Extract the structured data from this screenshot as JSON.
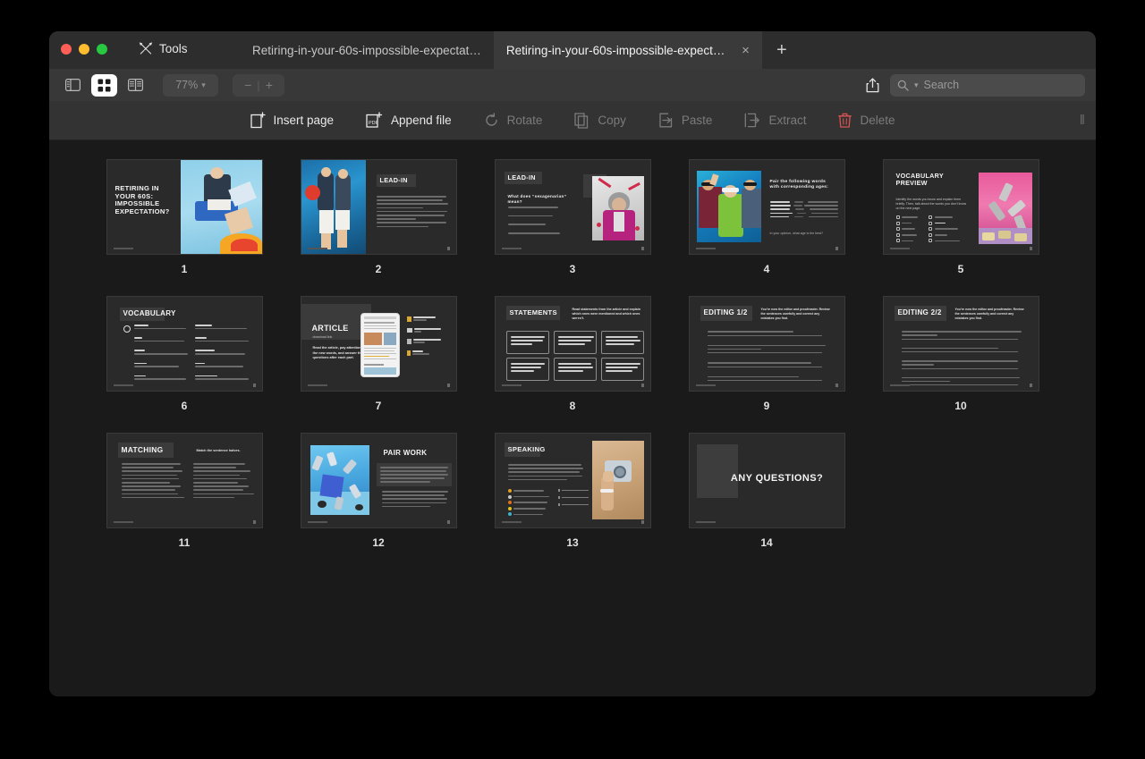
{
  "window": {
    "tools_label": "Tools",
    "traffic_lights": [
      "close",
      "minimize",
      "zoom"
    ]
  },
  "tabs": [
    {
      "label": "Retiring-in-your-60s-impossible-expectat…",
      "active": false
    },
    {
      "label": "Retiring-in-your-60s-impossible-expect…",
      "active": true
    }
  ],
  "new_tab_label": "+",
  "tab_close_label": "×",
  "toolbar": {
    "view_sidebar_icon": "sidebar-icon",
    "view_grid_icon": "grid-icon",
    "view_split_icon": "split-view-icon",
    "zoom_level": "77%",
    "zoom_chevron": "⌄",
    "zoom_out": "−",
    "zoom_sep": "|",
    "zoom_in": "+",
    "share_icon": "share-icon",
    "search_placeholder": "Search",
    "search_value": ""
  },
  "actions": [
    {
      "label": "Insert page",
      "icon": "insert-page-icon",
      "enabled": true
    },
    {
      "label": "Append file",
      "icon": "append-file-icon",
      "enabled": true
    },
    {
      "label": "Rotate",
      "icon": "rotate-icon",
      "enabled": false
    },
    {
      "label": "Copy",
      "icon": "copy-icon",
      "enabled": false
    },
    {
      "label": "Paste",
      "icon": "paste-icon",
      "enabled": false
    },
    {
      "label": "Extract",
      "icon": "extract-icon",
      "enabled": false
    },
    {
      "label": "Delete",
      "icon": "trash-icon",
      "enabled": false
    }
  ],
  "grip_label": "‖",
  "pages": [
    {
      "number": "1",
      "title": "RETIRING IN YOUR 60S: IMPOSSIBLE EXPECTATION?",
      "layout": "title-right-image",
      "selected": false
    },
    {
      "number": "2",
      "title": "LEAD-IN",
      "layout": "image-left-list-right",
      "selected": false
    },
    {
      "number": "3",
      "title": "LEAD-IN",
      "subtitle": "What does “sexagenarian” mean?",
      "layout": "list-left-image-right",
      "selected": false
    },
    {
      "number": "4",
      "title": "",
      "subtitle": "Pair the following words with corresponding ages:",
      "note": "In your opinion, what age is the best?",
      "layout": "image-left-pairs-right",
      "selected": false
    },
    {
      "number": "5",
      "title": "VOCABULARY PREVIEW",
      "subtitle": "Identify the words you know and explain them briefly. Then, talk about the words you don’t know on the next page.",
      "layout": "checklist-left-image-right",
      "selected": false
    },
    {
      "number": "6",
      "title": "VOCABULARY",
      "layout": "two-column-glossary",
      "selected": false
    },
    {
      "number": "7",
      "title": "ARTICLE",
      "subtitle": "download link",
      "body": "Read the article, pay attention to the new words, and answer the questions after each part.",
      "layout": "article-tablet",
      "selected": false
    },
    {
      "number": "8",
      "title": "STATEMENTS",
      "subtitle": "Read statements from the article and explain which ones were mentioned and which ones weren’t.",
      "layout": "statement-boxes",
      "selected": false
    },
    {
      "number": "9",
      "title": "EDITING 1/2",
      "subtitle": "You’re now the editor and proofreader. Review the sentences carefully and correct any mistakes you find.",
      "layout": "editing-lines",
      "selected": false
    },
    {
      "number": "10",
      "title": "EDITING 2/2",
      "subtitle": "You’re now the editor and proofreader. Review the sentences carefully and correct any mistakes you find.",
      "layout": "editing-lines",
      "selected": false
    },
    {
      "number": "11",
      "title": "MATCHING",
      "subtitle": "Match the sentence halves.",
      "layout": "matching-columns",
      "selected": false
    },
    {
      "number": "12",
      "title": "PAIR WORK",
      "layout": "image-left-quote-right",
      "selected": false
    },
    {
      "number": "13",
      "title": "SPEAKING",
      "layout": "speaking-image-right",
      "selected": false
    },
    {
      "number": "14",
      "title": "ANY QUESTIONS?",
      "layout": "closing",
      "selected": false
    }
  ],
  "page7_stats": [
    {
      "label": "Reading time",
      "value": "8 minutes"
    },
    {
      "label": "Number of words",
      "value": "880"
    },
    {
      "label": "New vocabulary",
      "value": "12 words"
    },
    {
      "label": "Level",
      "value": "Advanced"
    }
  ],
  "page8_statements": [
    "People are living longer, and daily life is getting more expensive.",
    "From 2000 to 2019, global life expectancy increased from 67 years to 73.",
    "Retiring has been the career goal for many workers around the world.",
    "Retirement age hasn’t changed much compared to the increasing life expectancy.",
    "Some governments are recognising that 65 is an outdated retirement age.",
    "Life expectancy has been continuing to go up since the mid-1800s in the UK."
  ],
  "colors": {
    "window_bg": "#2b2b2b",
    "titlebar_bg": "#2d2d2d",
    "tab_active_bg": "#3a3a3a",
    "toolbar1_bg": "#383838",
    "toolbar2_bg": "#333333",
    "page_area_bg": "#1a1a1a",
    "slide_bg": "#2a2a2a",
    "accent_red": "#d9534f",
    "traffic_red": "#ff5f57",
    "traffic_yellow": "#febc2e",
    "traffic_green": "#28c840"
  }
}
